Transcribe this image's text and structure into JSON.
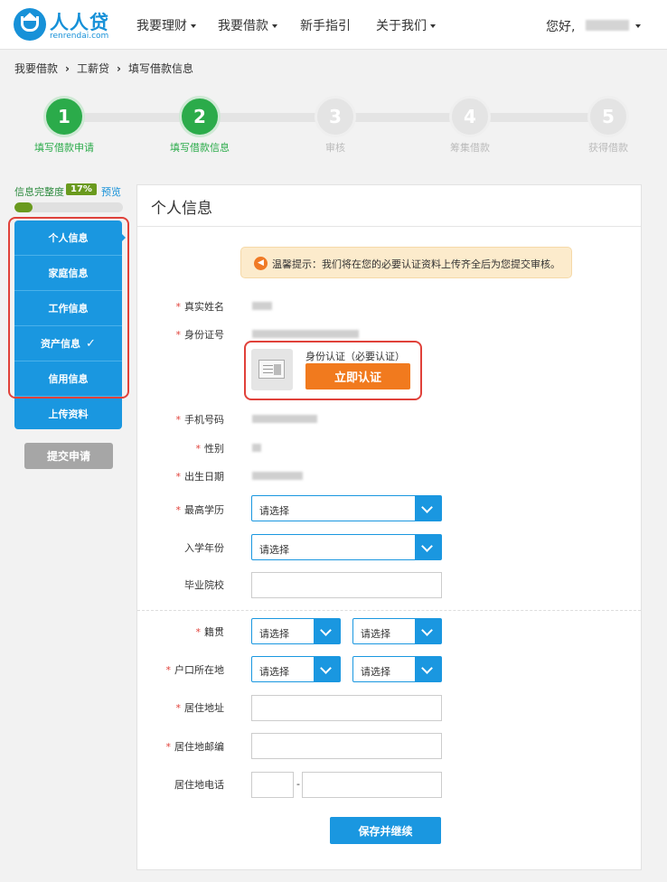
{
  "header": {
    "logo_name": "人人贷",
    "logo_domain": "renrendai.com",
    "nav": [
      {
        "label": "我要理财",
        "dropdown": true
      },
      {
        "label": "我要借款",
        "dropdown": true
      },
      {
        "label": "新手指引",
        "dropdown": false
      },
      {
        "label": "关于我们",
        "dropdown": true
      }
    ],
    "greeting": "您好,"
  },
  "breadcrumb": [
    "我要借款",
    "工薪贷",
    "填写借款信息"
  ],
  "steps": [
    {
      "num": "1",
      "label": "填写借款申请",
      "done": true
    },
    {
      "num": "2",
      "label": "填写借款信息",
      "done": true
    },
    {
      "num": "3",
      "label": "审核",
      "done": false
    },
    {
      "num": "4",
      "label": "筹集借款",
      "done": false
    },
    {
      "num": "5",
      "label": "获得借款",
      "done": false
    }
  ],
  "sidebar": {
    "completeness_label": "信息完整度",
    "completeness_pct": "17%",
    "completeness_value": 0.17,
    "preview_label": "预览",
    "items": [
      {
        "label": "个人信息",
        "active": true,
        "checked": false
      },
      {
        "label": "家庭信息",
        "active": false,
        "checked": false
      },
      {
        "label": "工作信息",
        "active": false,
        "checked": false
      },
      {
        "label": "资产信息",
        "active": false,
        "checked": true
      },
      {
        "label": "信用信息",
        "active": false,
        "checked": false
      },
      {
        "label": "上传资料",
        "active": false,
        "checked": false
      }
    ],
    "submit_label": "提交申请"
  },
  "panel": {
    "title": "个人信息",
    "notice": "温馨提示：我们将在您的必要认证资料上传齐全后为您提交审核。",
    "fields": {
      "real_name": "真实姓名",
      "id_number": "身份证号",
      "mobile": "手机号码",
      "gender": "性别",
      "birth_date": "出生日期",
      "education": "最高学历",
      "enroll_year": "入学年份",
      "school": "毕业院校",
      "native_place": "籍贯",
      "hukou": "户口所在地",
      "address": "居住地址",
      "postcode": "居住地邮编",
      "phone": "居住地电话"
    },
    "id_auth": {
      "title": "身份认证（必要认证）",
      "button": "立即认证"
    },
    "select_placeholder": "请选择",
    "phone_separator": "-",
    "save_label": "保存并继续"
  },
  "colors": {
    "brand_blue": "#1a97e0",
    "step_green": "#2bab4a",
    "progress_green": "#6a9a1e",
    "action_orange": "#f17a1e",
    "required_red": "#e0413a",
    "highlight_red": "#e0413a"
  }
}
